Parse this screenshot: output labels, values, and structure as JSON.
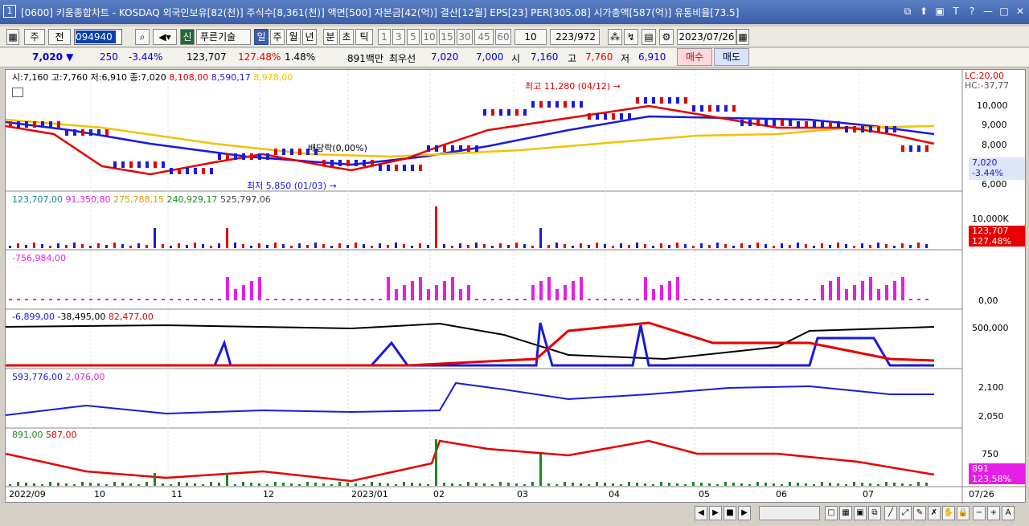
{
  "title": {
    "num": "1",
    "text": "[0600] 키움종합차트 - KOSDAQ 외국인보유[82(천)] 주식수[8,361(천)] 액면[500] 자본금[42(억)] 결산[12월] EPS[23] PER[305.08] 시가총액[587(억)] 유통비율[73.5]"
  },
  "window_buttons": [
    "⧉",
    "⬆",
    "▣",
    "T",
    "?",
    "—",
    "□",
    "✕"
  ],
  "toolbar": {
    "period1": "주",
    "period2": "전",
    "code": "094940",
    "sin": "신",
    "name": "푸른기술",
    "tf": [
      "일",
      "주",
      "월",
      "년",
      "분",
      "초",
      "틱"
    ],
    "nums": [
      "1",
      "3",
      "5",
      "10",
      "15",
      "30",
      "45",
      "60"
    ],
    "count": "10",
    "range": "223/972",
    "date": "2023/07/26"
  },
  "quote": {
    "price": "7,020 ▼",
    "change": "250",
    "pct": "-3.44%",
    "volume": "123,707",
    "vol_pct": "127.48%",
    "turnover": "1.48%",
    "amount": "891백만",
    "best_label": "최우선",
    "bid": "7,020",
    "ask": "7,000",
    "open_l": "시",
    "open": "7,160",
    "high_l": "고",
    "high": "7,760",
    "low_l": "저",
    "low": "6,910",
    "buy": "매수",
    "sell": "매도"
  },
  "panels": {
    "price_legend": {
      "ohlc": "시:7,160 고:7,760 저:6,910 종:7,020",
      "ma1": "8,108,00",
      "ma2": "8,590,17",
      "ma3": "8,978,00"
    },
    "price_axis": [
      "10,000",
      "9,000",
      "8,000",
      "6,000"
    ],
    "price_lc": "LC:20,00",
    "price_hc": "HC:-37,77",
    "price_cur": "7,020",
    "price_cur_pct": "-3.44%",
    "ann_high": "최고 11,280 (04/12) →",
    "ann_low": "최저 5,850 (01/03) →",
    "ann_div": "배당락(0,00%)",
    "vol_legend": [
      "123,707,00",
      "91,350,80",
      "275,788,15",
      "240,929,17",
      "525,797,06"
    ],
    "vol_axis": "10,000K",
    "vol_cur": "123,707",
    "vol_pct": "127.48%",
    "p3_legend": "-756,984,00",
    "p3_axis": "0,00",
    "p4_legend": [
      "-6,899,00",
      "-38,495,00",
      "82,477,00"
    ],
    "p4_axis": "500,000",
    "p5_legend": [
      "593,776,00",
      "2,076,00"
    ],
    "p5_axis": [
      "2,100",
      "2,050"
    ],
    "p6_legend": [
      "891,00",
      "587,00"
    ],
    "p6_axis": "750",
    "p6_cur": "891",
    "p6_pct": "123.58%"
  },
  "xaxis": [
    "2022/09",
    "10",
    "11",
    "12",
    "2023/01",
    "02",
    "03",
    "04",
    "05",
    "06",
    "07",
    "07/26"
  ],
  "colors": {
    "red": "#e60000",
    "blue": "#1a1adc",
    "yellow": "#f2c200",
    "magenta": "#e61ee6",
    "green": "#1a8a1a",
    "black": "#000000"
  }
}
